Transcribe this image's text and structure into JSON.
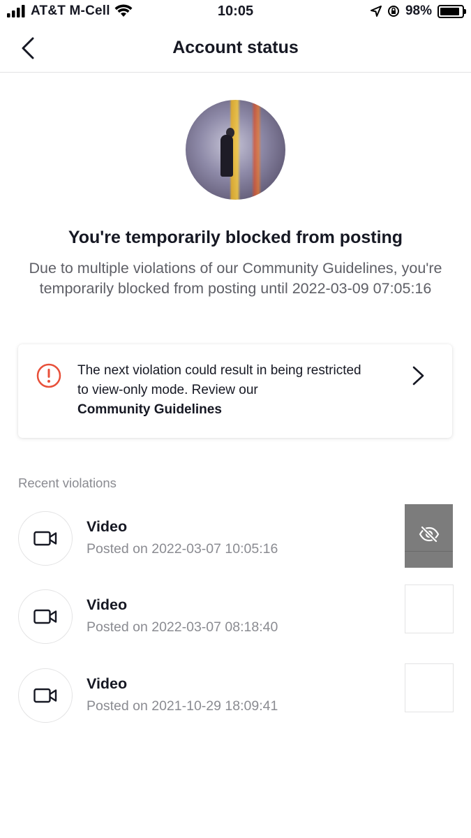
{
  "status_bar": {
    "carrier": "AT&T M-Cell",
    "time": "10:05",
    "battery_percent": "98%",
    "battery_level": 0.98
  },
  "header": {
    "title": "Account status"
  },
  "status": {
    "headline": "You're temporarily blocked from posting",
    "description": "Due to multiple violations of our Community Guidelines, you're temporarily blocked from posting until 2022-03-09 07:05:16"
  },
  "warning_card": {
    "text": "The next violation could result in being restricted to view-only mode. Review our",
    "link": "Community Guidelines"
  },
  "violations": {
    "section_label": "Recent violations",
    "items": [
      {
        "type": "Video",
        "posted": "Posted on 2022-03-07 10:05:16",
        "thumbnail": "hidden-content"
      },
      {
        "type": "Video",
        "posted": "Posted on 2022-03-07 08:18:40",
        "thumbnail": "blank"
      },
      {
        "type": "Video",
        "posted": "Posted on 2021-10-29 18:09:41",
        "thumbnail": "blank"
      }
    ]
  },
  "colors": {
    "warning_red": "#e8503a",
    "text_primary": "#161823",
    "text_secondary": "#8a8b91"
  }
}
